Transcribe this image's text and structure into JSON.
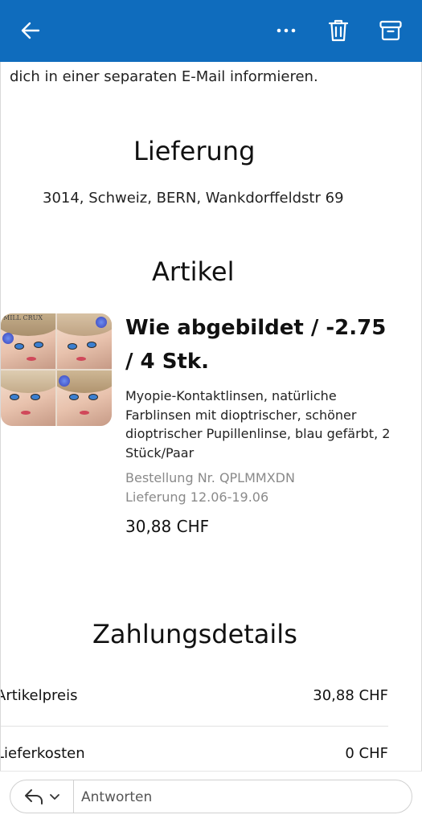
{
  "toolbar": {
    "back_icon": "arrow-left-icon",
    "more_icon": "more-horizontal-icon",
    "delete_icon": "trash-icon",
    "archive_icon": "archive-icon",
    "accent_color": "#0f6cbd"
  },
  "email": {
    "intro_text": "dich in einer separaten E-Mail informieren.",
    "delivery": {
      "heading": "Lieferung",
      "address": "3014, Schweiz, BERN, Wankdorffeldstr 69"
    },
    "items": {
      "heading": "Artikel",
      "product": {
        "brand_mark": "MILL CRUX",
        "title": "Wie abgebildet / -2.75 / 4 Stk.",
        "description": "Myopie-Kontaktlinsen, natürliche Farblinsen mit dioptrischer, schöner dioptrischer Pupillenlinse, blau gefärbt, 2 Stück/Paar",
        "order_number": "Bestellung Nr. QPLMMXDN",
        "delivery_window": "Lieferung 12.06-19.06",
        "price": "30,88 CHF"
      }
    },
    "payment": {
      "heading": "Zahlungsdetails",
      "rows": [
        {
          "label": "Artikelpreis",
          "value": "30,88 CHF"
        },
        {
          "label": "Lieferkosten",
          "value": "0 CHF"
        }
      ]
    }
  },
  "reply_bar": {
    "reply_icon": "reply-icon",
    "chevron_icon": "chevron-down-icon",
    "placeholder": "Antworten"
  }
}
